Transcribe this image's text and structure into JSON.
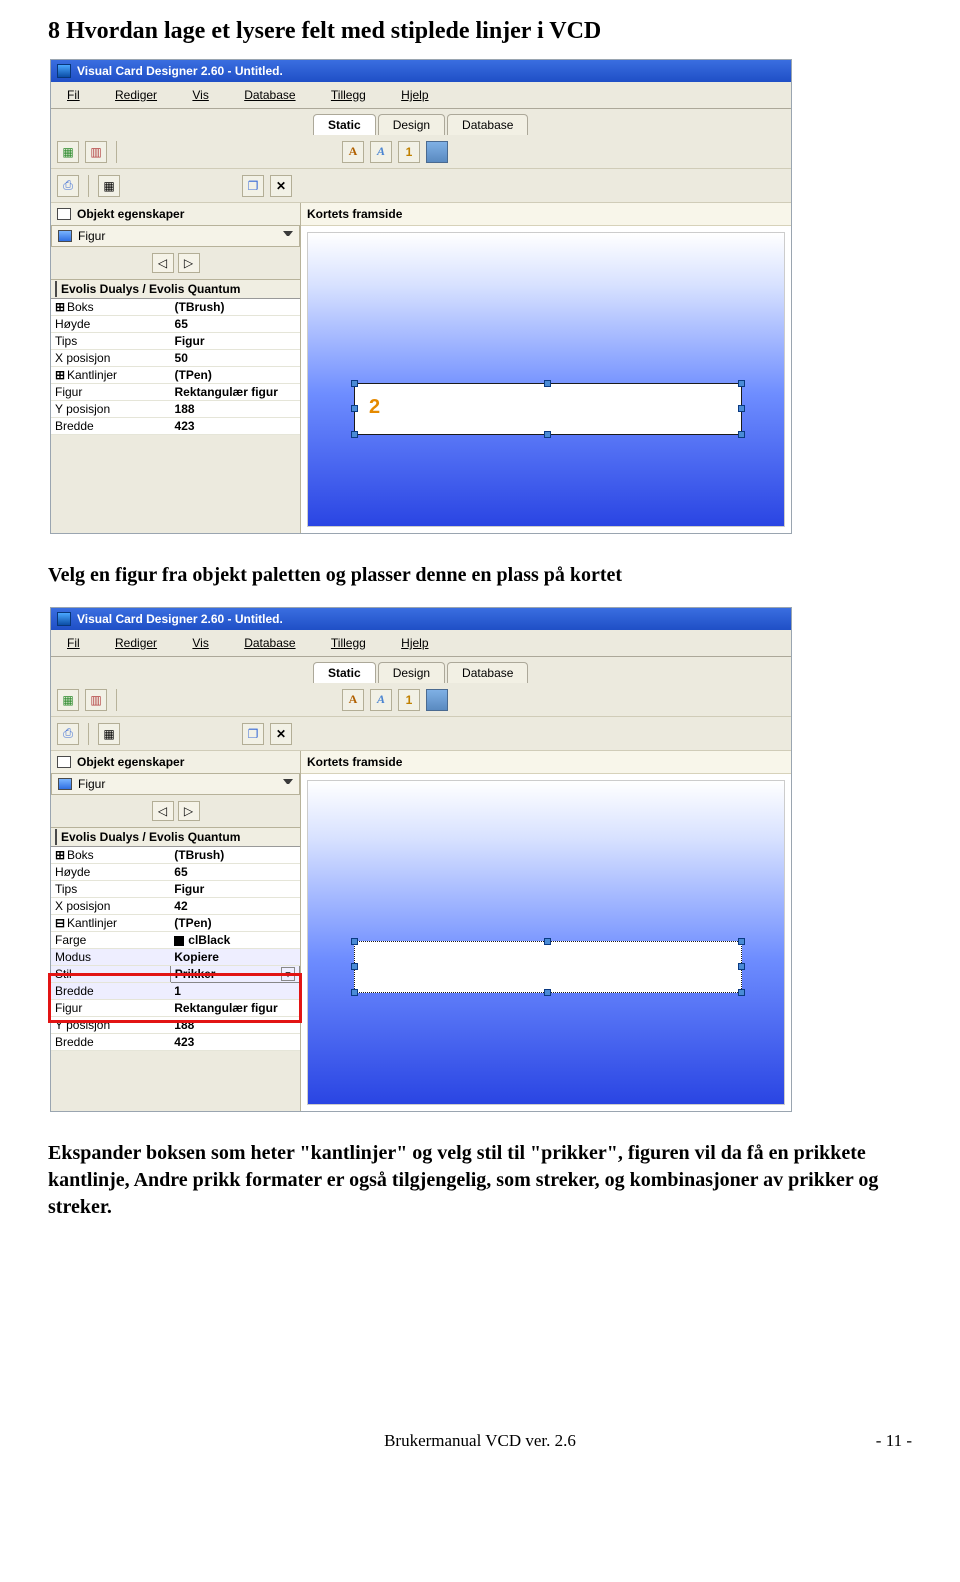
{
  "heading": "8 Hvordan lage et lysere felt med stiplede linjer i VCD",
  "para1": "Velg en figur fra objekt paletten og plasser denne en plass på kortet",
  "para2": "Ekspander boksen som heter \"kantlinjer\" og velg stil til \"prikker\", figuren vil da få en prikkete kantlinje, Andre prikk formater er også tilgjengelig, som streker, og kombinasjoner av prikker og streker.",
  "app": {
    "title": "Visual Card Designer 2.60 - Untitled.",
    "menu": [
      "Fil",
      "Rediger",
      "Vis",
      "Database",
      "Tillegg",
      "Hjelp"
    ],
    "tabs": [
      "Static",
      "Design",
      "Database"
    ],
    "panelHeader": "Objekt egenskaper",
    "figur": "Figur",
    "canvasCaption": "Kortets framside",
    "pgheader": "Evolis Dualys / Evolis Quantum",
    "number": "2"
  },
  "grid1": [
    {
      "k": "Boks",
      "v": "(TBrush)",
      "exp": "⊞"
    },
    {
      "k": "Høyde",
      "v": "65"
    },
    {
      "k": "Tips",
      "v": "Figur"
    },
    {
      "k": "X posisjon",
      "v": "50"
    },
    {
      "k": "Kantlinjer",
      "v": "(TPen)",
      "exp": "⊞"
    },
    {
      "k": "Figur",
      "v": "Rektangulær figur"
    },
    {
      "k": "Y posisjon",
      "v": "188"
    },
    {
      "k": "Bredde",
      "v": "423"
    }
  ],
  "grid2_top": [
    {
      "k": "Boks",
      "v": "(TBrush)",
      "exp": "⊞"
    },
    {
      "k": "Høyde",
      "v": "65"
    },
    {
      "k": "Tips",
      "v": "Figur"
    },
    {
      "k": "X posisjon",
      "v": "42"
    },
    {
      "k": "Kantlinjer",
      "v": "(TPen)",
      "exp": "⊟"
    },
    {
      "k": "Farge",
      "v": "clBlack",
      "indent": true,
      "swatch": "#000"
    }
  ],
  "grid2_mid": [
    {
      "k": "Modus",
      "v": "Kopiere",
      "indent": true
    },
    {
      "k": "Stil",
      "v": "Prikker",
      "indent": true,
      "dropdown": true
    },
    {
      "k": "Bredde",
      "v": "1",
      "indent": true
    }
  ],
  "grid2_bot": [
    {
      "k": "Figur",
      "v": "Rektangulær figur"
    },
    {
      "k": "Y posisjon",
      "v": "188"
    },
    {
      "k": "Bredde",
      "v": "423"
    }
  ],
  "footer": {
    "center": "Brukermanual VCD ver. 2.6",
    "right": "- 11 -"
  }
}
